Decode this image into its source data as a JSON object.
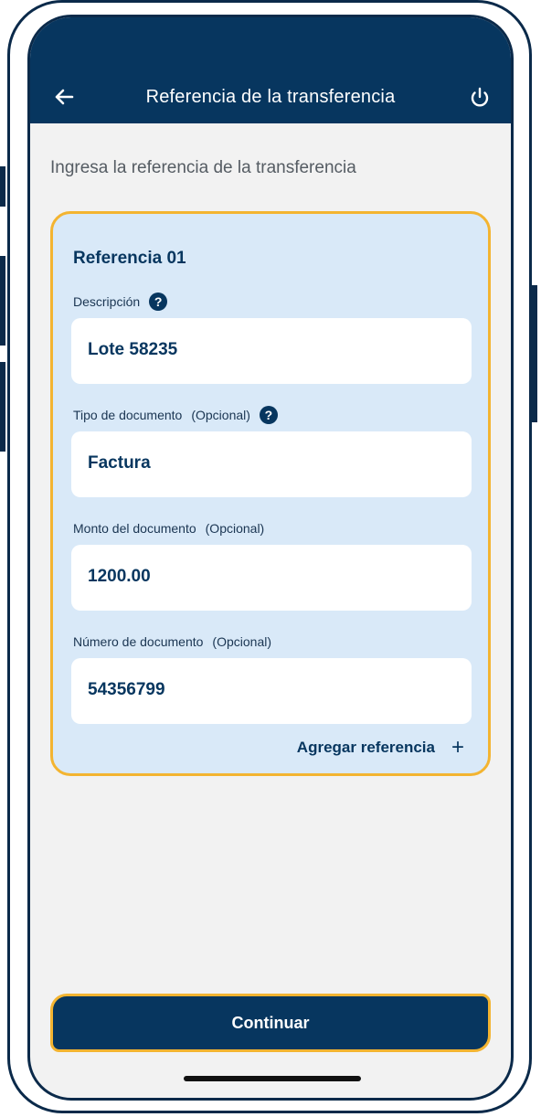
{
  "header": {
    "title": "Referencia de la transferencia",
    "back_icon": "arrow-left-icon",
    "power_icon": "power-icon"
  },
  "instruction": "Ingresa la referencia de la transferencia",
  "reference_card": {
    "title": "Referencia 01",
    "fields": [
      {
        "label": "Descripción",
        "optional": "",
        "value": "Lote 58235",
        "help": true
      },
      {
        "label": "Tipo de documento",
        "optional": "(Opcional)",
        "value": "Factura",
        "help": true
      },
      {
        "label": "Monto del documento",
        "optional": "(Opcional)",
        "value": "1200.00",
        "help": false
      },
      {
        "label": "Número de documento",
        "optional": "(Opcional)",
        "value": "54356799",
        "help": false
      }
    ],
    "help_glyph": "?",
    "add_label": "Agregar referencia",
    "add_glyph": "+"
  },
  "footer": {
    "continue_label": "Continuar"
  },
  "colors": {
    "primary": "#07365f",
    "highlight": "#f3b431",
    "card_bg": "#d9e9f8"
  }
}
